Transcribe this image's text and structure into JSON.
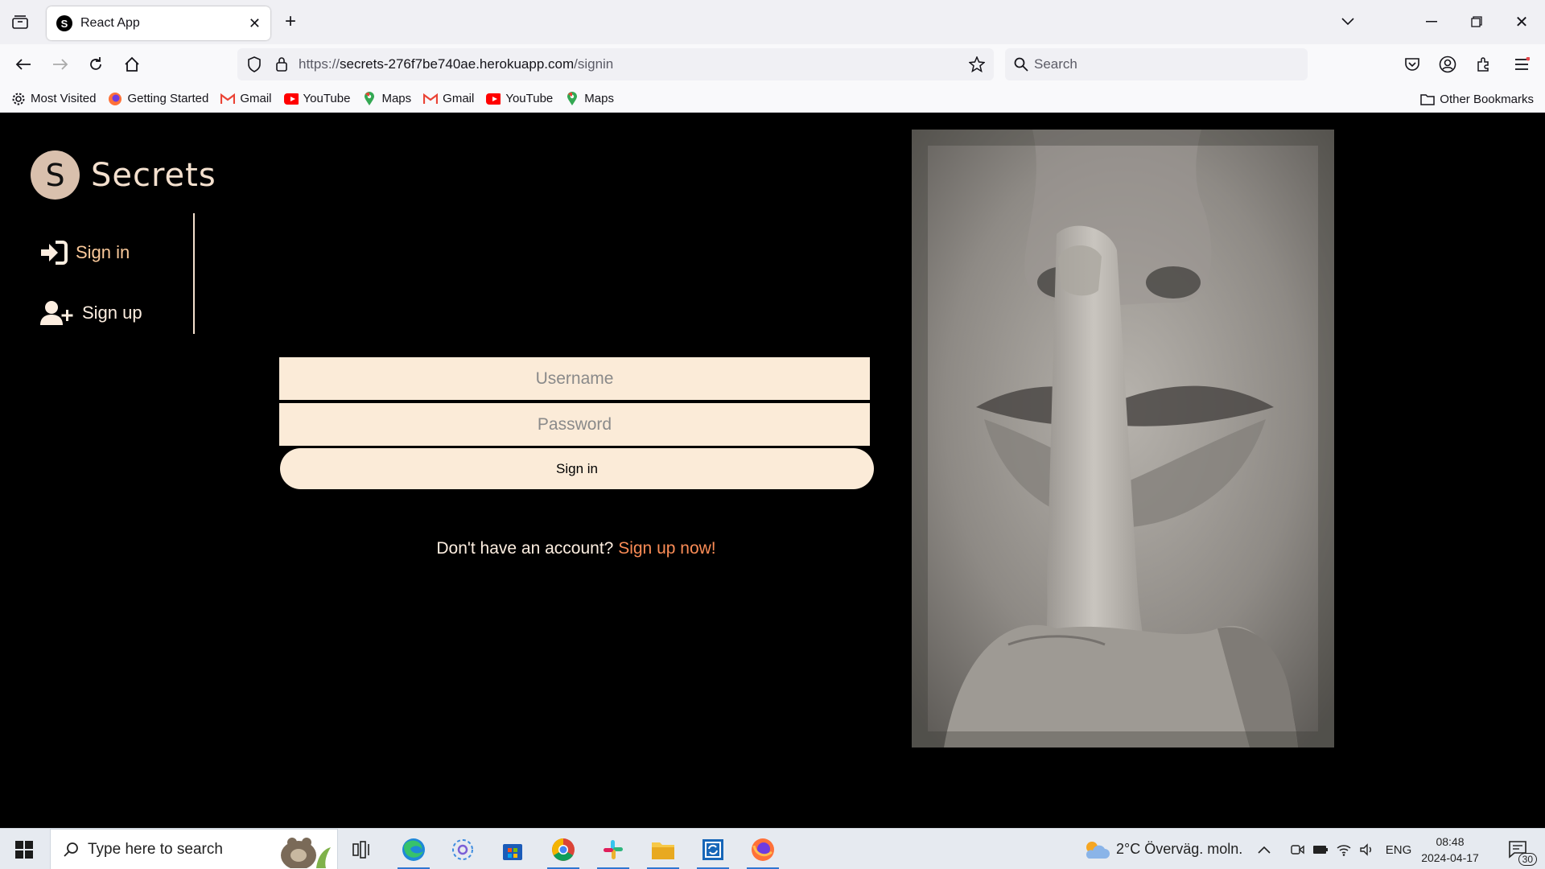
{
  "browser": {
    "tab_title": "React App",
    "tab_favicon": "S",
    "url_scheme": "https://",
    "url_host": "secrets-276f7be740ae.herokuapp.com",
    "url_path": "/signin",
    "search_placeholder": "Search",
    "bookmarks": [
      {
        "label": "Most Visited",
        "icon": "gear-icon"
      },
      {
        "label": "Getting Started",
        "icon": "firefox-icon"
      },
      {
        "label": "Gmail",
        "icon": "gmail-icon"
      },
      {
        "label": "YouTube",
        "icon": "youtube-icon"
      },
      {
        "label": "Maps",
        "icon": "maps-icon"
      },
      {
        "label": "Gmail",
        "icon": "gmail-icon"
      },
      {
        "label": "YouTube",
        "icon": "youtube-icon"
      },
      {
        "label": "Maps",
        "icon": "maps-icon"
      }
    ],
    "other_bookmarks": "Other Bookmarks"
  },
  "app": {
    "logo_letter": "S",
    "logo_text": "Secrets",
    "nav": {
      "signin": "Sign in",
      "signup": "Sign up"
    },
    "form": {
      "username_placeholder": "Username",
      "password_placeholder": "Password",
      "submit_label": "Sign in"
    },
    "account_prompt": "Don't have an account?",
    "account_link": "Sign up now!",
    "colors": {
      "accent": "#fbc99a",
      "link": "#fb8c56",
      "field_bg": "#fbebd8"
    }
  },
  "taskbar": {
    "search_placeholder": "Type here to search",
    "weather": "2°C  Överväg. moln.",
    "language": "ENG",
    "time": "08:48",
    "date": "2024-04-17",
    "notification_count": "30"
  }
}
